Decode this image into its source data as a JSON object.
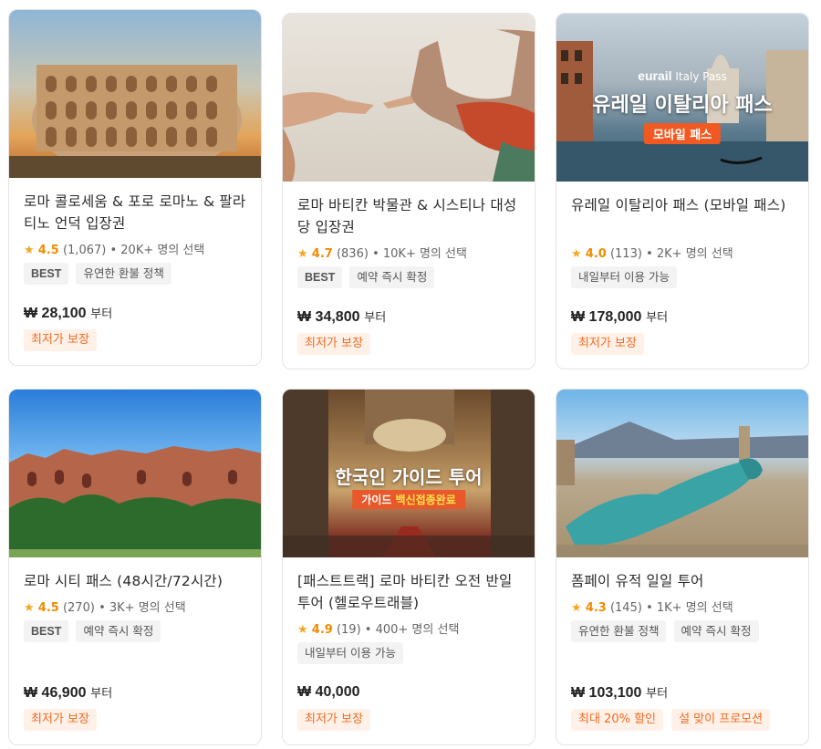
{
  "cards": [
    {
      "title": "로마 콜로세움 & 포로 로마노 & 팔라티노 언덕 입장권",
      "star": "★",
      "score": "4.5",
      "reviews": "(1,067)",
      "selections": "• 20K+ 명의 선택",
      "tags": [
        "BEST",
        "유연한 환불 정책"
      ],
      "price": "₩ 28,100",
      "price_suffix": "부터",
      "promos": [
        "최저가 보장"
      ]
    },
    {
      "title": "로마 바티칸 박물관 & 시스티나 대성당 입장권",
      "star": "★",
      "score": "4.7",
      "reviews": "(836)",
      "selections": "• 10K+ 명의 선택",
      "tags": [
        "BEST",
        "예약 즉시 확정"
      ],
      "price": "₩ 34,800",
      "price_suffix": "부터",
      "promos": [
        "최저가 보장"
      ]
    },
    {
      "title": "유레일 이탈리아 패스 (모바일 패스)",
      "star": "★",
      "score": "4.0",
      "reviews": "(113)",
      "selections": "• 2K+ 명의 선택",
      "tags": [
        "내일부터 이용 가능"
      ],
      "price": "₩ 178,000",
      "price_suffix": "부터",
      "promos": [
        "최저가 보장"
      ],
      "image_brand": "eurail",
      "image_brand_sub": "Italy Pass",
      "image_title": "유레일 이탈리아 패스",
      "image_pill": "모바일 패스"
    },
    {
      "title": "로마 시티 패스 (48시간/72시간)",
      "star": "★",
      "score": "4.5",
      "reviews": "(270)",
      "selections": "• 3K+ 명의 선택",
      "tags": [
        "BEST",
        "예약 즉시 확정"
      ],
      "price": "₩ 46,900",
      "price_suffix": "부터",
      "promos": [
        "최저가 보장"
      ]
    },
    {
      "title": "[패스트트랙] 로마 바티칸 오전 반일투어 (헬로우트래블)",
      "star": "★",
      "score": "4.9",
      "reviews": "(19)",
      "selections": "• 400+ 명의 선택",
      "tags": [
        "내일부터 이용 가능"
      ],
      "price": "₩ 40,000",
      "price_suffix": "",
      "promos": [
        "최저가 보장"
      ],
      "image_title": "한국인 가이드 투어",
      "image_pill_a": "가이드",
      "image_pill_b": "백신접종완료"
    },
    {
      "title": "폼페이 유적 일일 투어",
      "star": "★",
      "score": "4.3",
      "reviews": "(145)",
      "selections": "• 1K+ 명의 선택",
      "tags": [
        "유연한 환불 정책",
        "예약 즉시 확정"
      ],
      "price": "₩ 103,100",
      "price_suffix": "부터",
      "promos": [
        "최대 20% 할인",
        "설 맞이 프로모션"
      ]
    }
  ],
  "colors": {
    "star": "#f5a623",
    "score": "#f08c00",
    "promo_text": "#f36b21",
    "promo_bg": "#fff1e8",
    "tag_bg": "#f3f3f3",
    "pill_bg": "#f05a22"
  }
}
